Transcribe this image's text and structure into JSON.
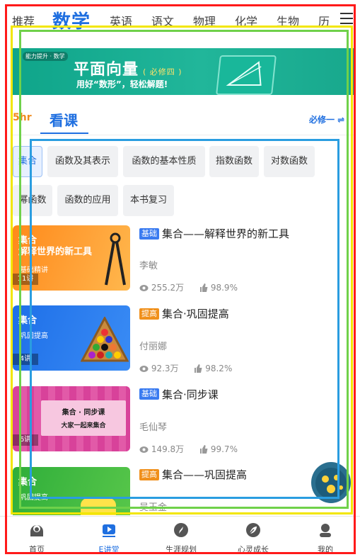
{
  "top_nav": {
    "subjects": [
      "推荐",
      "数学",
      "英语",
      "语文",
      "物理",
      "化学",
      "生物",
      "历"
    ],
    "active_index": 1
  },
  "banner": {
    "tag": "能力提升 · 数学",
    "title": "平面向量",
    "title_note": "( 必修四 )",
    "subtitle": "用好“数形”，轻松解题!"
  },
  "course_header": {
    "left_text": "5hr",
    "tab": "看课",
    "right_text": "必修一 ⇌"
  },
  "chips": [
    "集合",
    "函数及其表示",
    "函数的基本性质",
    "指数函数",
    "对数函数",
    "幂函数",
    "函数的应用",
    "本书复习"
  ],
  "courses": [
    {
      "level": "基础",
      "title": "集合——解释世界的新工具",
      "teacher": "李敏",
      "views": "255.2万",
      "likes": "98.9%",
      "thumb_title": "集合\n解释世界的新工具",
      "thumb_sub": "基础精讲",
      "thumb_count": "11讲"
    },
    {
      "level": "提高",
      "title": "集合·巩固提高",
      "teacher": "付丽娜",
      "views": "92.3万",
      "likes": "98.2%",
      "thumb_title": "集合",
      "thumb_sub": "巩固提高",
      "thumb_count": "4讲"
    },
    {
      "level": "基础",
      "title": "集合·同步课",
      "teacher": "毛仙琴",
      "views": "149.8万",
      "likes": "99.7%",
      "thumb_title": "集合 · 同步课",
      "thumb_sub": "大家一起来集合",
      "thumb_count": "6讲"
    },
    {
      "level": "提高",
      "title": "集合——巩固提高",
      "teacher": "吴玉金",
      "views": "",
      "likes": "",
      "thumb_title": "集合",
      "thumb_sub": "巩固提高",
      "thumb_count": ""
    }
  ],
  "bottom_nav": {
    "items": [
      "首页",
      "E讲堂",
      "生涯规划",
      "心灵成长",
      "我的"
    ],
    "active_index": 1
  },
  "colors": {
    "accent": "#1f6fe0",
    "base_badge": "#3a7bf0",
    "advance_badge": "#f0901c",
    "overlay_red": "#ff1a1a",
    "overlay_yellow": "#f2e600",
    "overlay_green": "#6fd14a",
    "overlay_blue": "#2a9de0"
  }
}
